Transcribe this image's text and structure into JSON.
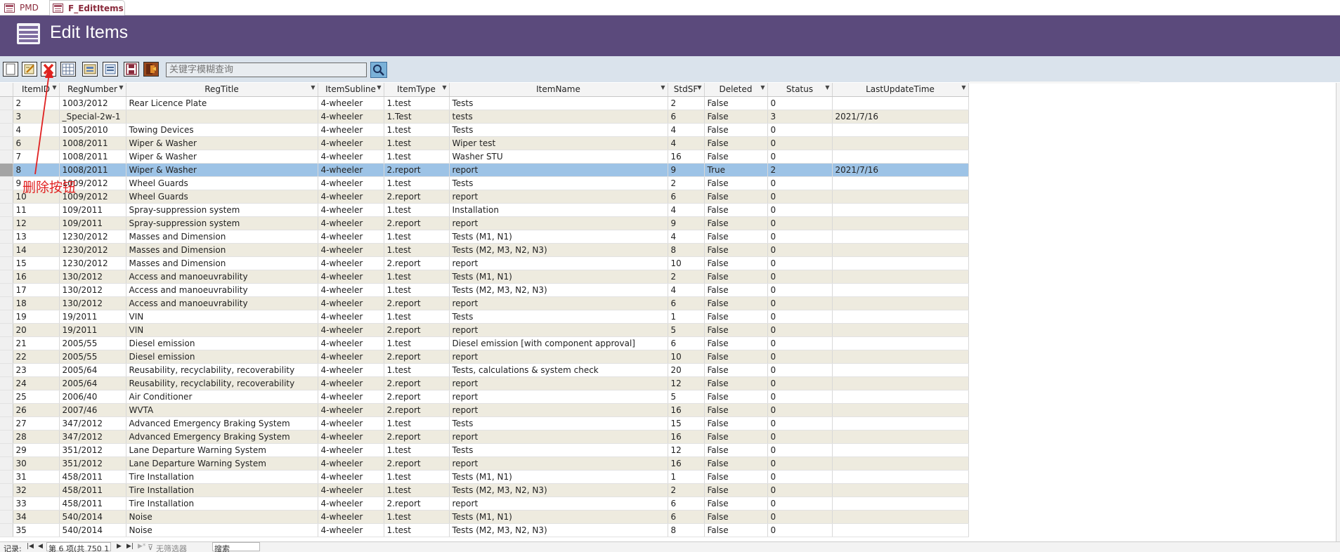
{
  "tabs": [
    {
      "label": "PMD",
      "icon": "form-icon"
    },
    {
      "label": "F_EditItems",
      "icon": "form-icon"
    }
  ],
  "header": {
    "title": "Edit Items",
    "icon": "form-header-icon"
  },
  "toolbar": {
    "buttons": [
      {
        "name": "new-record-button",
        "icon": "blank-page-icon"
      },
      {
        "name": "edit-record-button",
        "icon": "edit-icon"
      },
      {
        "name": "delete-record-button",
        "icon": "delete-x-icon"
      },
      {
        "name": "datasheet-view-button",
        "icon": "table-grid-icon"
      },
      {
        "name": "open-form-button",
        "icon": "form-icon"
      },
      {
        "name": "refresh-button",
        "icon": "form-refresh-icon"
      },
      {
        "name": "save-button",
        "icon": "floppy-disk-icon"
      },
      {
        "name": "exit-button",
        "icon": "door-exit-icon"
      }
    ],
    "search_placeholder": "关键字模糊查询",
    "search_button_icon": "magnifier-icon"
  },
  "colors": {
    "header_bg": "#5b4a7c",
    "toolbar_bg": "#dae3ec",
    "alt_row": "#eeebdf",
    "selected_row": "#9dc3e6",
    "annotation": "#e02020"
  },
  "grid": {
    "columns": [
      "ItemID",
      "RegNumber",
      "RegTitle",
      "ItemSubline",
      "ItemType",
      "ItemName",
      "StdSF",
      "Deleted",
      "Status",
      "LastUpdateTime"
    ],
    "current_row_index": 5,
    "rows": [
      [
        "2",
        "1003/2012",
        "Rear Licence Plate",
        "4-wheeler",
        "1.test",
        "Tests",
        "2",
        "False",
        "0",
        ""
      ],
      [
        "3",
        "_Special-2w-1",
        "",
        "4-wheeler",
        "1.Test",
        "tests",
        "6",
        "False",
        "3",
        "2021/7/16"
      ],
      [
        "4",
        "1005/2010",
        "Towing Devices",
        "4-wheeler",
        "1.test",
        "Tests",
        "4",
        "False",
        "0",
        ""
      ],
      [
        "6",
        "1008/2011",
        "Wiper & Washer",
        "4-wheeler",
        "1.test",
        "Wiper test",
        "4",
        "False",
        "0",
        ""
      ],
      [
        "7",
        "1008/2011",
        "Wiper & Washer",
        "4-wheeler",
        "1.test",
        "Washer STU",
        "16",
        "False",
        "0",
        ""
      ],
      [
        "8",
        "1008/2011",
        "Wiper & Washer",
        "4-wheeler",
        "2.report",
        "report",
        "9",
        "True",
        "2",
        "2021/7/16"
      ],
      [
        "9",
        "1009/2012",
        "Wheel Guards",
        "4-wheeler",
        "1.test",
        "Tests",
        "2",
        "False",
        "0",
        ""
      ],
      [
        "10",
        "1009/2012",
        "Wheel Guards",
        "4-wheeler",
        "2.report",
        "report",
        "6",
        "False",
        "0",
        ""
      ],
      [
        "11",
        "109/2011",
        "Spray-suppression system",
        "4-wheeler",
        "1.test",
        "Installation",
        "4",
        "False",
        "0",
        ""
      ],
      [
        "12",
        "109/2011",
        "Spray-suppression system",
        "4-wheeler",
        "2.report",
        "report",
        "9",
        "False",
        "0",
        ""
      ],
      [
        "13",
        "1230/2012",
        "Masses and Dimension",
        "4-wheeler",
        "1.test",
        "Tests (M1, N1)",
        "4",
        "False",
        "0",
        ""
      ],
      [
        "14",
        "1230/2012",
        "Masses and Dimension",
        "4-wheeler",
        "1.test",
        "Tests (M2, M3, N2, N3)",
        "8",
        "False",
        "0",
        ""
      ],
      [
        "15",
        "1230/2012",
        "Masses and Dimension",
        "4-wheeler",
        "2.report",
        "report",
        "10",
        "False",
        "0",
        ""
      ],
      [
        "16",
        "130/2012",
        "Access and manoeuvrability",
        "4-wheeler",
        "1.test",
        "Tests (M1, N1)",
        "2",
        "False",
        "0",
        ""
      ],
      [
        "17",
        "130/2012",
        "Access and manoeuvrability",
        "4-wheeler",
        "1.test",
        "Tests (M2, M3, N2, N3)",
        "4",
        "False",
        "0",
        ""
      ],
      [
        "18",
        "130/2012",
        "Access and manoeuvrability",
        "4-wheeler",
        "2.report",
        "report",
        "6",
        "False",
        "0",
        ""
      ],
      [
        "19",
        "19/2011",
        "VIN",
        "4-wheeler",
        "1.test",
        "Tests",
        "1",
        "False",
        "0",
        ""
      ],
      [
        "20",
        "19/2011",
        "VIN",
        "4-wheeler",
        "2.report",
        "report",
        "5",
        "False",
        "0",
        ""
      ],
      [
        "21",
        "2005/55",
        "Diesel emission",
        "4-wheeler",
        "1.test",
        "Diesel emission [with component approval]",
        "6",
        "False",
        "0",
        ""
      ],
      [
        "22",
        "2005/55",
        "Diesel emission",
        "4-wheeler",
        "2.report",
        "report",
        "10",
        "False",
        "0",
        ""
      ],
      [
        "23",
        "2005/64",
        "Reusability, recyclability, recoverability",
        "4-wheeler",
        "1.test",
        "Tests, calculations & system check",
        "20",
        "False",
        "0",
        ""
      ],
      [
        "24",
        "2005/64",
        "Reusability, recyclability, recoverability",
        "4-wheeler",
        "2.report",
        "report",
        "12",
        "False",
        "0",
        ""
      ],
      [
        "25",
        "2006/40",
        "Air Conditioner",
        "4-wheeler",
        "2.report",
        "report",
        "5",
        "False",
        "0",
        ""
      ],
      [
        "26",
        "2007/46",
        "WVTA",
        "4-wheeler",
        "2.report",
        "report",
        "16",
        "False",
        "0",
        ""
      ],
      [
        "27",
        "347/2012",
        "Advanced Emergency Braking System",
        "4-wheeler",
        "1.test",
        "Tests",
        "15",
        "False",
        "0",
        ""
      ],
      [
        "28",
        "347/2012",
        "Advanced Emergency Braking System",
        "4-wheeler",
        "2.report",
        "report",
        "16",
        "False",
        "0",
        ""
      ],
      [
        "29",
        "351/2012",
        "Lane Departure Warning System",
        "4-wheeler",
        "1.test",
        "Tests",
        "12",
        "False",
        "0",
        ""
      ],
      [
        "30",
        "351/2012",
        "Lane Departure Warning System",
        "4-wheeler",
        "2.report",
        "report",
        "16",
        "False",
        "0",
        ""
      ],
      [
        "31",
        "458/2011",
        "Tire Installation",
        "4-wheeler",
        "1.test",
        "Tests (M1, N1)",
        "1",
        "False",
        "0",
        ""
      ],
      [
        "32",
        "458/2011",
        "Tire Installation",
        "4-wheeler",
        "1.test",
        "Tests (M2, M3, N2, N3)",
        "2",
        "False",
        "0",
        ""
      ],
      [
        "33",
        "458/2011",
        "Tire Installation",
        "4-wheeler",
        "2.report",
        "report",
        "6",
        "False",
        "0",
        ""
      ],
      [
        "34",
        "540/2014",
        "Noise",
        "4-wheeler",
        "1.test",
        "Tests (M1, N1)",
        "6",
        "False",
        "0",
        ""
      ],
      [
        "35",
        "540/2014",
        "Noise",
        "4-wheeler",
        "1.test",
        "Tests (M2, M3, N2, N3)",
        "8",
        "False",
        "0",
        ""
      ]
    ]
  },
  "navigation": {
    "record_label": "记录:",
    "position_text": "第 6 项(共 750 1",
    "filter_text": "无筛选器",
    "search_text": "搜索"
  },
  "annotation": {
    "text": "删除按钮"
  }
}
